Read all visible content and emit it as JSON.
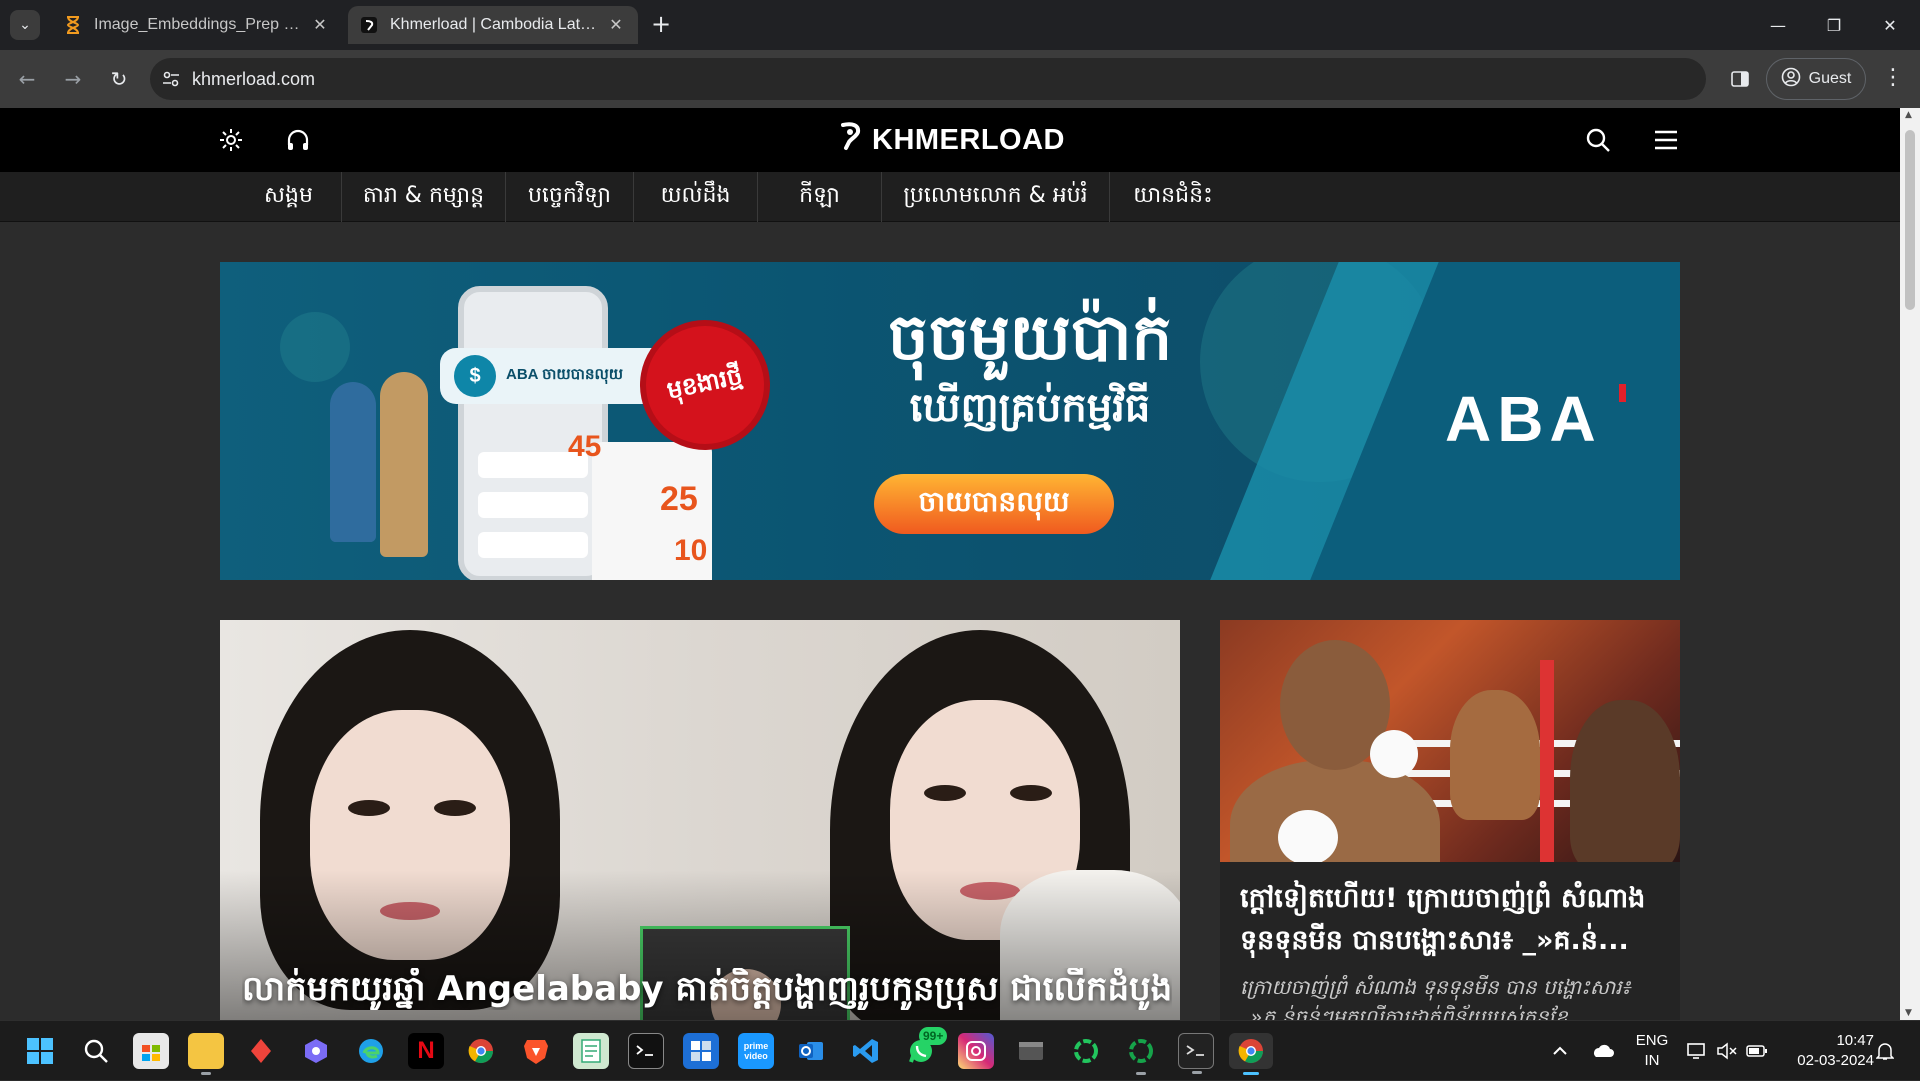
{
  "browser": {
    "tabs": [
      {
        "title": "Image_Embeddings_Prep - Jupy",
        "active": false,
        "icon": "hourglass-icon"
      },
      {
        "title": "Khmerload | Cambodia Latest N",
        "active": true,
        "icon": "khmerload-favicon"
      }
    ],
    "new_tab": "+",
    "url": "khmerload.com",
    "profile_label": "Guest"
  },
  "site": {
    "logo_text": "KHMERLOAD",
    "categories": [
      "សង្គម",
      "តារា & កម្សាន្ត",
      "បច្ចេកវិទ្យា",
      "យល់ដឹង",
      "កីឡា",
      "ប្រលោមលោក & អប់រំ",
      "យានជំនិះ"
    ]
  },
  "banner": {
    "brand": "ABA",
    "app_label": "ABA ចាយបានលុយ",
    "badge": "មុខងារថ្មី",
    "headline": "ចុចមួយប៉ាក់",
    "subheadline": "ឃើញគ្រប់កម្មវិធី",
    "cta": "ចាយបានលុយ",
    "percents": [
      "45",
      "25",
      "10"
    ],
    "accent_color": "#e3202a",
    "background_color": "#0b5572"
  },
  "stories": {
    "main": {
      "title": "លាក់មកយូរឆ្នាំ Angelababy គាត់ចិត្តបង្ហាញរូបកូនប្រុស ជាលើកដំបូង"
    },
    "side": {
      "title": "ក្តៅទៀតហើយ! ក្រោយចាញ់ព្រំ សំណាង ទុនទុនមីន បានបង្ហោះសារ៖ _»គ.ន់...",
      "excerpt": "ក្រោយចាញ់ព្រំ សំណាង ទុនទុនមីន បាន បង្ហោះសារ៖ _»គ.ន់ធន់ៗមកលើការដាក់ពិន័យរបស់គនខែ..."
    }
  },
  "taskbar": {
    "apps": [
      "start",
      "search",
      "store",
      "file-explorer",
      "anydesk",
      "app",
      "edge",
      "netflix",
      "chrome",
      "brave",
      "notepad",
      "terminal",
      "windows-app",
      "prime-video",
      "outlook",
      "vscode",
      "whatsapp",
      "instagram",
      "app",
      "app",
      "app",
      "powershell",
      "chrome-active"
    ],
    "whatsapp_badge": "99+",
    "prime_label": "prime video",
    "language": "ENG",
    "region": "IN",
    "time": "10:47",
    "date": "02-03-2024"
  }
}
